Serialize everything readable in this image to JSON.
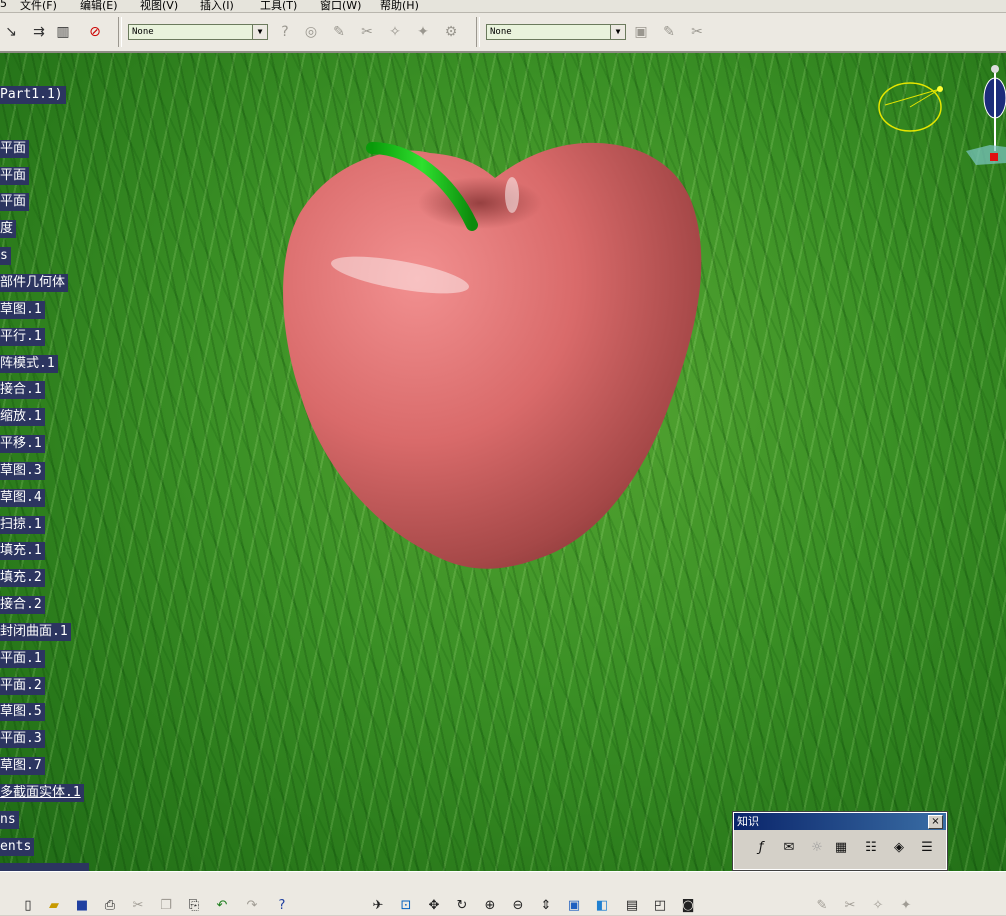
{
  "menu": [
    "5",
    "文件(F)",
    "编辑(E)",
    "视图(V)",
    "插入(I)",
    "工具(T)",
    "窗口(W)",
    "帮助(H)"
  ],
  "toolbar": {
    "combo1_value": "None",
    "combo2_value": "None"
  },
  "tree": {
    "items": [
      "Part1.1)",
      "平面",
      "平面",
      "平面",
      "度",
      "s",
      "部件几何体",
      "草图.1",
      "平行.1",
      "阵模式.1",
      "接合.1",
      "缩放.1",
      "平移.1",
      "草图.3",
      "草图.4",
      "扫掠.1",
      "填充.1",
      "填充.2",
      "接合.2",
      "封闭曲面.1",
      "平面.1",
      "平面.2",
      "草图.5",
      "平面.3",
      "草图.7",
      "多截面实体.1",
      "ns",
      "ents",
      "_"
    ]
  },
  "knowledge": {
    "title": "知识",
    "close": "×",
    "icons": [
      "formula-icon",
      "comment-icon",
      "lightbulb-icon",
      "table-icon",
      "tree-icon",
      "cube-icon",
      "list-icon"
    ]
  },
  "colors": {
    "tree_bg": "#2c3560",
    "apple": "#d96a6a",
    "stem": "#1ecf1e",
    "title_bar": "#0a246a"
  }
}
